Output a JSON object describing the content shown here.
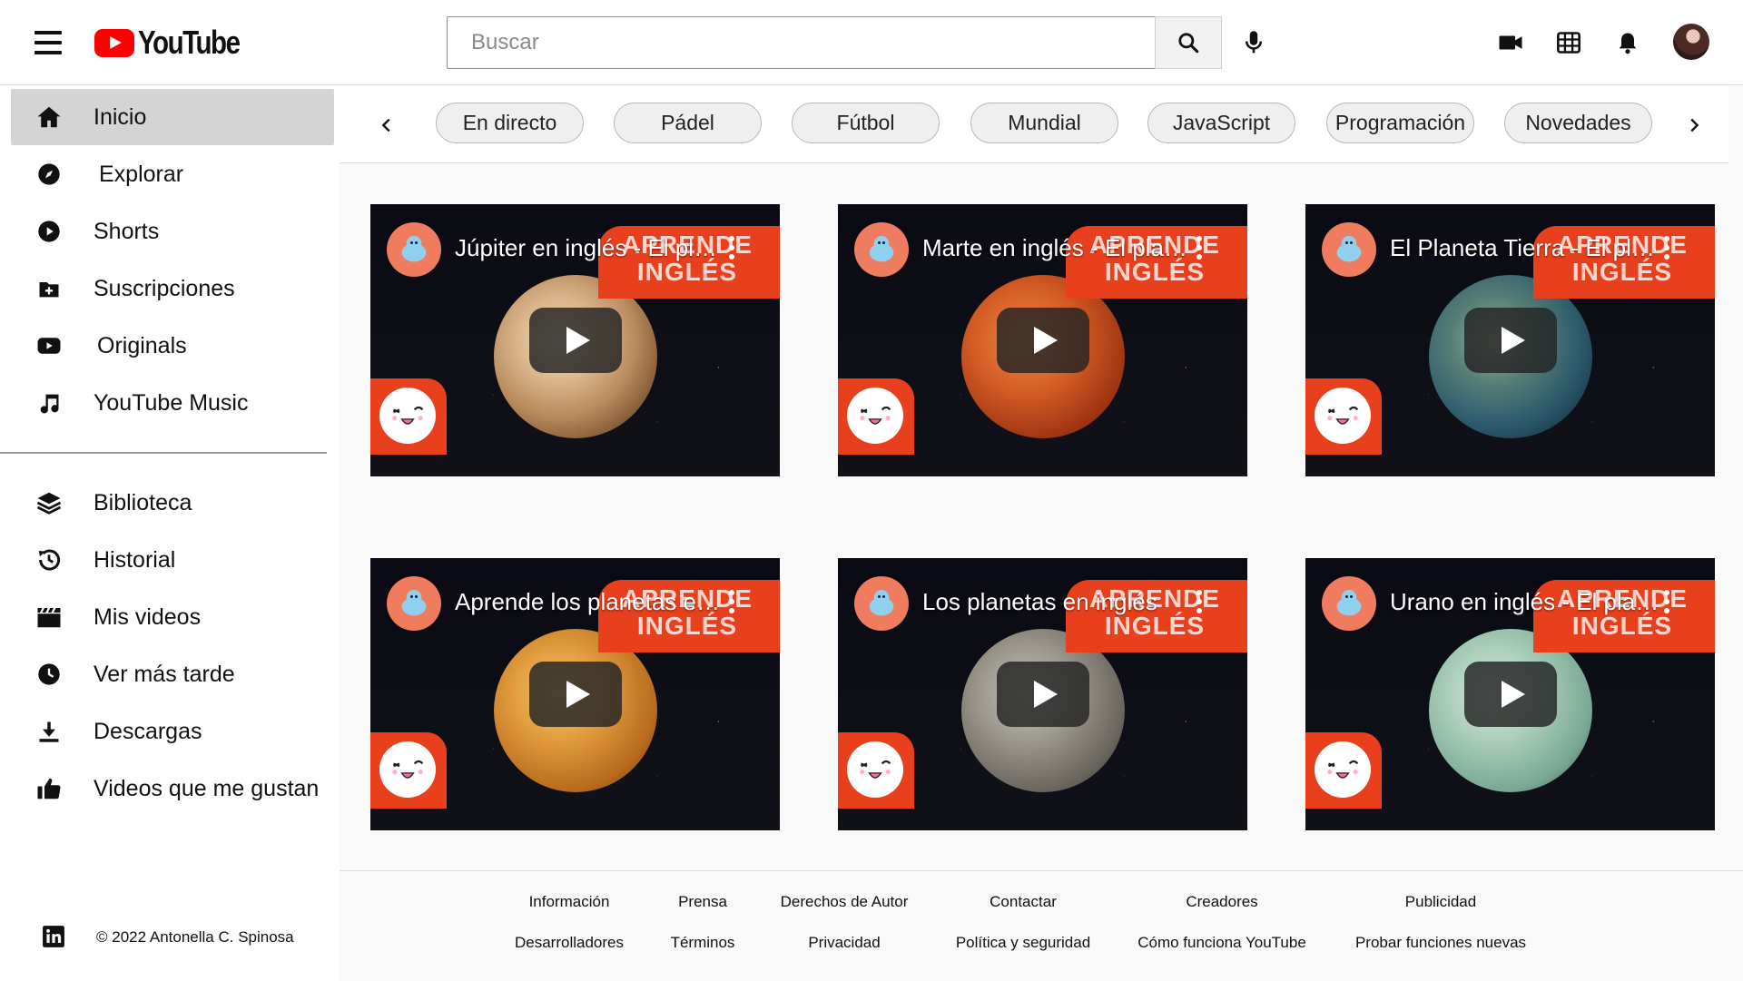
{
  "header": {
    "logo_text": "YouTube",
    "search_placeholder": "Buscar"
  },
  "sidebar": {
    "items_top": [
      {
        "label": "Inicio",
        "icon": "home-icon",
        "active": true
      },
      {
        "label": "Explorar",
        "icon": "compass-icon"
      },
      {
        "label": "Shorts",
        "icon": "shorts-icon"
      },
      {
        "label": "Suscripciones",
        "icon": "subscriptions-icon"
      },
      {
        "label": "Originals",
        "icon": "originals-icon"
      },
      {
        "label": "YouTube Music",
        "icon": "music-note-icon"
      }
    ],
    "items_bottom": [
      {
        "label": "Biblioteca",
        "icon": "library-icon"
      },
      {
        "label": "Historial",
        "icon": "history-icon"
      },
      {
        "label": "Mis videos",
        "icon": "clapperboard-icon"
      },
      {
        "label": "Ver más tarde",
        "icon": "clock-icon"
      },
      {
        "label": "Descargas",
        "icon": "download-icon"
      },
      {
        "label": "Videos que me gustan",
        "icon": "thumbs-up-icon"
      }
    ],
    "copyright": "© 2022 Antonella C. Spinosa"
  },
  "chips": [
    "En directo",
    "Pádel",
    "Fútbol",
    "Mundial",
    "JavaScript",
    "Programación",
    "Novedades"
  ],
  "videos": [
    {
      "title": "Júpiter en inglés - El planeta Júpiter",
      "banner": "APRENDE INGLÉS",
      "planet_color": "jupiter"
    },
    {
      "title": "Marte en inglés - El planeta Marte",
      "banner": "APRENDE INGLÉS",
      "planet_color": "mars"
    },
    {
      "title": "El Planeta Tierra - El planeta",
      "banner": "APRENDE INGLÉS",
      "planet_color": "earth"
    },
    {
      "title": "Aprende los planetas en inglés",
      "banner": "APRENDE INGLÉS",
      "planet_color": "venus"
    },
    {
      "title": "Los planetas en inglés",
      "banner": "APRENDE INGLÉS",
      "planet_color": "mercury"
    },
    {
      "title": "Urano en inglés - El planeta Urano",
      "banner": "APRENDE INGLÉS",
      "planet_color": "uranus"
    }
  ],
  "footer": {
    "row1": [
      "Información",
      "Prensa",
      "Derechos de Autor",
      "Contactar",
      "Creadores",
      "Publicidad"
    ],
    "row2": [
      "Desarrolladores",
      "Términos",
      "Privacidad",
      "Política y seguridad",
      "Cómo funciona YouTube",
      "Probar funciones nuevas"
    ]
  },
  "colors": {
    "brand_red": "#ff0000",
    "banner_orange": "#e8401d",
    "active_bg": "#d4d4d4"
  }
}
